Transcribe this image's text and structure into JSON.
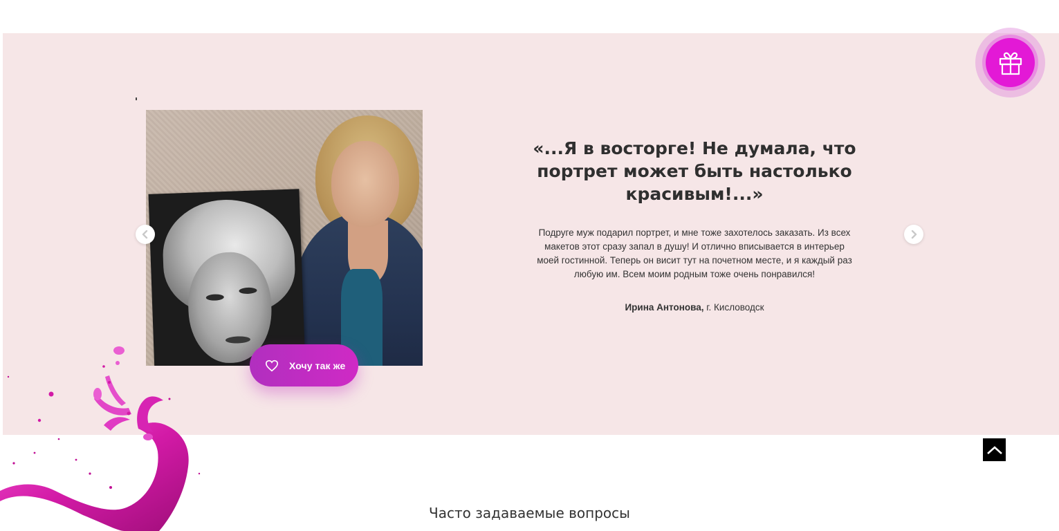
{
  "review": {
    "quote_title": "«...Я в восторге! Не думала, что портрет может быть настолько красивым!...»",
    "text": "Подруге муж подарил портрет, и мне тоже захотелось заказать. Из всех макетов этот сразу запал в душу! И отлично вписывается в интерьер моей гостинной. Теперь он висит тут на почетном месте, и я каждый раз любую им. Всем моим родным тоже очень понравился!",
    "author_name": "Ирина Антонова,",
    "author_city": "г. Кисловодск",
    "want_same_label": "Хочу так же"
  },
  "carousel": {
    "prev_icon": "chevron-left-icon",
    "next_icon": "chevron-right-icon"
  },
  "floating": {
    "gift_icon": "gift-icon",
    "scroll_top_icon": "chevron-up-icon"
  },
  "faq": {
    "heading": "Часто задаваемые вопросы"
  },
  "colors": {
    "section_bg": "#f6e6e7",
    "accent_magenta": "#e319d6",
    "button_purple": "#b12fbf"
  }
}
